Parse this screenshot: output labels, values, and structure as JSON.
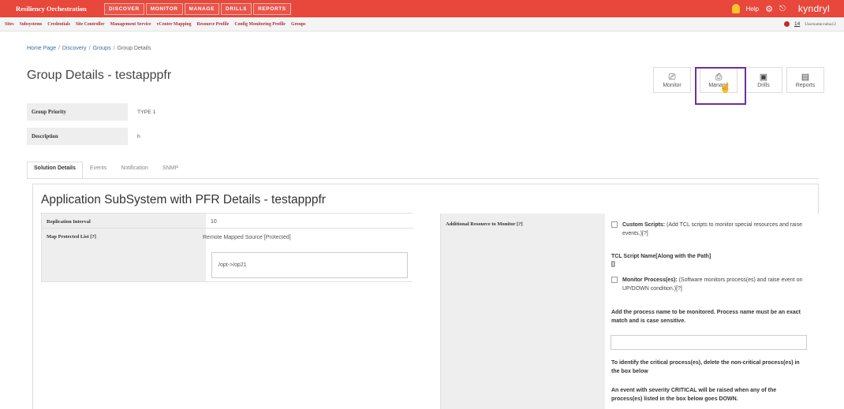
{
  "topbar": {
    "brand": "Resiliency Orchestration",
    "nav": [
      "DISCOVER",
      "MONITOR",
      "MANAGE",
      "DRILLS",
      "REPORTS"
    ],
    "help_label": "Help",
    "logo": "kyndryl"
  },
  "subbar": {
    "links": [
      "Sites",
      "Subsystems",
      "Credentials",
      "Site Controller",
      "Management Service",
      "vCenter Mapping",
      "Resource Profile",
      "Config Monitoring Profile",
      "Groups"
    ],
    "alert_count": "14",
    "username": "Username:neha12"
  },
  "breadcrumb": [
    "Home Page",
    "Discovery",
    "Groups",
    "Group Details"
  ],
  "page_title": "Group Details - testapppfr",
  "actions": [
    {
      "label": "Monitor",
      "icon": "monitor-icon"
    },
    {
      "label": "Manage",
      "icon": "manage-icon"
    },
    {
      "label": "Drills",
      "icon": "drills-icon"
    },
    {
      "label": "Reports",
      "icon": "reports-icon"
    }
  ],
  "info": {
    "priority_label": "Group Priority",
    "priority_value": "TYPE 1",
    "description_label": "Description",
    "description_value": "h"
  },
  "tabs": [
    "Solution Details",
    "Events",
    "Notification",
    "SNMP"
  ],
  "panel": {
    "title": "Application SubSystem with PFR Details - testapppfr",
    "replication_label": "Replication Interval",
    "replication_value": "10",
    "map_label": "Map Protected List [?]",
    "map_value": "Remote Mapped Source [Protected]",
    "path_value": "/opt->/op21",
    "additional_label": "Additional Resource to Monitor [?]",
    "custom_scripts_bold": "Custom Scripts:",
    "custom_scripts_text": " (Add TCL scripts to monitor special resources and raise events.)[?]",
    "tcl_label": "TCL Script Name[Along with the Path]",
    "tcl_value": "[]",
    "monitor_proc_bold": "Monitor Process(es):",
    "monitor_proc_text": " (Software monitors process(es) and raise event on UP/DOWN condition.)[?]",
    "add_process_text": "Add the process name to be monitored. Process name must be an exact match and is case sensitive.",
    "identify_text": "To identify the critical process(es), delete the non-critical process(es) in the box below",
    "critical_text": "An event with severity CRITICAL will be raised when any of the process(es) listed in the box below goes DOWN."
  }
}
